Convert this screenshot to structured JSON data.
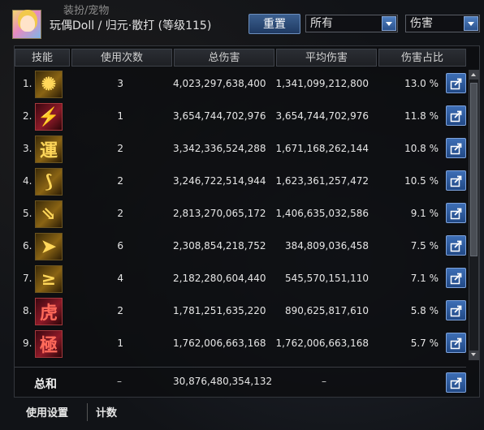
{
  "background_tab_text": "装扮/宠物",
  "header": {
    "character_title": "玩偶Doll / 归元·散打 (等级115)",
    "reset_label": "重置",
    "filter_select": "所有",
    "type_select": "伤害"
  },
  "columns": {
    "skill": "技能",
    "count": "使用次数",
    "total": "总伤害",
    "avg": "平均伤害",
    "pct": "伤害占比"
  },
  "rows": [
    {
      "rank": "1.",
      "icon": "burst-icon",
      "glyph": "✺",
      "count": "3",
      "total": "4,023,297,638,400",
      "avg": "1,341,099,212,800",
      "pct": "13.0 %"
    },
    {
      "rank": "2.",
      "icon": "slash-icon",
      "glyph": "⚡",
      "count": "1",
      "total": "3,654,744,702,976",
      "avg": "3,654,744,702,976",
      "pct": "11.8 %"
    },
    {
      "rank": "3.",
      "icon": "yun-character-icon",
      "glyph": "運",
      "count": "2",
      "total": "3,342,336,524,288",
      "avg": "1,671,168,262,144",
      "pct": "10.8 %"
    },
    {
      "rank": "4.",
      "icon": "swirl-icon",
      "glyph": "⟆",
      "count": "2",
      "total": "3,246,722,514,944",
      "avg": "1,623,361,257,472",
      "pct": "10.5 %"
    },
    {
      "rank": "5.",
      "icon": "streak-icon",
      "glyph": "⇘",
      "count": "2",
      "total": "2,813,270,065,172",
      "avg": "1,406,635,032,586",
      "pct": "9.1 %"
    },
    {
      "rank": "6.",
      "icon": "shockwave-icon",
      "glyph": "➤",
      "count": "6",
      "total": "2,308,854,218,752",
      "avg": "384,809,036,458",
      "pct": "7.5 %"
    },
    {
      "rank": "7.",
      "icon": "spike-icon",
      "glyph": "≥",
      "count": "4",
      "total": "2,182,280,604,440",
      "avg": "545,570,151,110",
      "pct": "7.1 %"
    },
    {
      "rank": "8.",
      "icon": "hu-character-icon",
      "glyph": "虎",
      "count": "2",
      "total": "1,781,251,635,220",
      "avg": "890,625,817,610",
      "pct": "5.8 %"
    },
    {
      "rank": "9.",
      "icon": "ji-character-icon",
      "glyph": "極",
      "count": "1",
      "total": "1,762,006,663,168",
      "avg": "1,762,006,663,168",
      "pct": "5.7 %"
    }
  ],
  "total_row": {
    "label": "总和",
    "count": "–",
    "total": "30,876,480,354,132",
    "avg": "–"
  },
  "bottom_tabs": {
    "settings": "使用设置",
    "count": "计数"
  },
  "colors": {
    "accent_blue": "#2f5c9e",
    "icon_gold": "#ffd75a",
    "icon_red": "#ff6a5a"
  }
}
